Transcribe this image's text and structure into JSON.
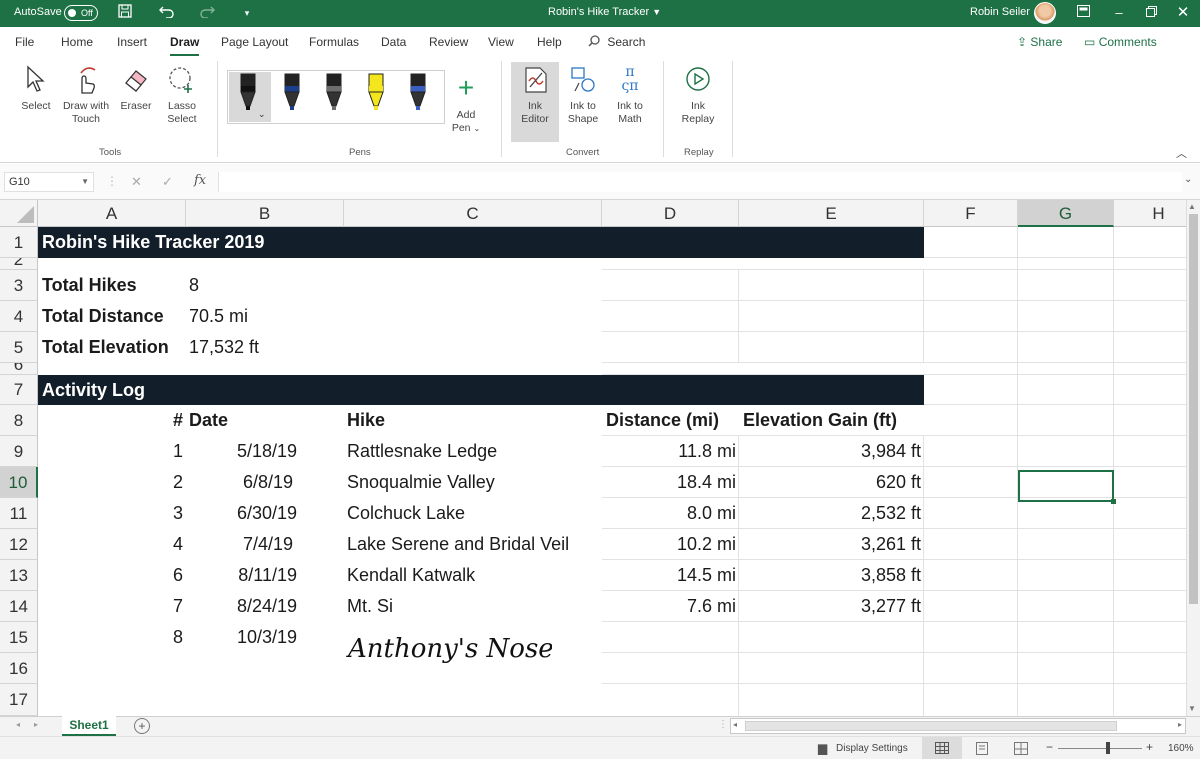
{
  "titlebar": {
    "autosave_label": "AutoSave",
    "autosave_state": "Off",
    "doc_title": "Robin's Hike Tracker",
    "user_name": "Robin Seiler",
    "icons": [
      "save-icon",
      "undo-icon",
      "redo-icon",
      "customize-icon",
      "ribbon-display-icon",
      "minimize-icon",
      "restore-icon",
      "close-icon"
    ]
  },
  "menu": {
    "items": [
      "File",
      "Home",
      "Insert",
      "Draw",
      "Page Layout",
      "Formulas",
      "Data",
      "Review",
      "View",
      "Help"
    ],
    "active": "Draw",
    "search_label": "Search",
    "share_label": "Share",
    "comments_label": "Comments"
  },
  "ribbon": {
    "tools": {
      "select_label": "Select",
      "draw_touch_line1": "Draw with",
      "draw_touch_line2": "Touch",
      "eraser_label": "Eraser",
      "lasso_line1": "Lasso",
      "lasso_line2": "Select",
      "group_label": "Tools"
    },
    "pens": {
      "group_label": "Pens",
      "add_pen_line1": "Add",
      "add_pen_line2": "Pen",
      "pen_colors": [
        "#111111",
        "#1c3f8c",
        "#6e6e6e",
        "#f4e61c",
        "#3b5fc0"
      ]
    },
    "convert": {
      "ink_editor_line1": "Ink",
      "ink_editor_line2": "Editor",
      "ink_shape_line1": "Ink to",
      "ink_shape_line2": "Shape",
      "ink_math_line1": "Ink to",
      "ink_math_line2": "Math",
      "group_label": "Convert"
    },
    "replay": {
      "ink_replay_line1": "Ink",
      "ink_replay_line2": "Replay",
      "group_label": "Replay"
    }
  },
  "formula_bar": {
    "name_box": "G10",
    "fx_label": "fx",
    "value": ""
  },
  "columns": [
    "A",
    "B",
    "C",
    "D",
    "E",
    "F",
    "G",
    "H"
  ],
  "rows": [
    "1",
    "2",
    "3",
    "4",
    "5",
    "6",
    "7",
    "8",
    "9",
    "10",
    "11",
    "12",
    "13",
    "14",
    "15",
    "16",
    "17"
  ],
  "sheet": {
    "title": "Robin's Hike Tracker 2019",
    "summary": [
      {
        "label": "Total Hikes",
        "value": "8"
      },
      {
        "label": "Total Distance",
        "value": "70.5 mi"
      },
      {
        "label": "Total Elevation",
        "value": "17,532 ft"
      }
    ],
    "log_title": "Activity Log",
    "headers": {
      "num": "#",
      "date": "Date",
      "hike": "Hike",
      "distance": "Distance (mi)",
      "elevation": "Elevation Gain (ft)"
    },
    "log": [
      {
        "num": "1",
        "date": "5/18/19",
        "hike": "Rattlesnake Ledge",
        "distance": "11.8 mi",
        "elevation": "3,984 ft"
      },
      {
        "num": "2",
        "date": "6/8/19",
        "hike": "Snoqualmie Valley",
        "distance": "18.4 mi",
        "elevation": "620 ft"
      },
      {
        "num": "3",
        "date": "6/30/19",
        "hike": "Colchuck Lake",
        "distance": "8.0 mi",
        "elevation": "2,532 ft"
      },
      {
        "num": "4",
        "date": "7/4/19",
        "hike": "Lake Serene and Bridal Veil",
        "distance": "10.2 mi",
        "elevation": "3,261 ft"
      },
      {
        "num": "6",
        "date": "8/11/19",
        "hike": "Kendall Katwalk",
        "distance": "14.5 mi",
        "elevation": "3,858 ft"
      },
      {
        "num": "7",
        "date": "8/24/19",
        "hike": "Mt. Si",
        "distance": "7.6 mi",
        "elevation": "3,277 ft"
      },
      {
        "num": "8",
        "date": "10/3/19",
        "hike": "",
        "distance": "",
        "elevation": ""
      }
    ],
    "ink_annotation": "Anthony's Nose"
  },
  "sheet_tabs": {
    "active": "Sheet1"
  },
  "status": {
    "display_settings": "Display Settings",
    "zoom": "160%"
  }
}
